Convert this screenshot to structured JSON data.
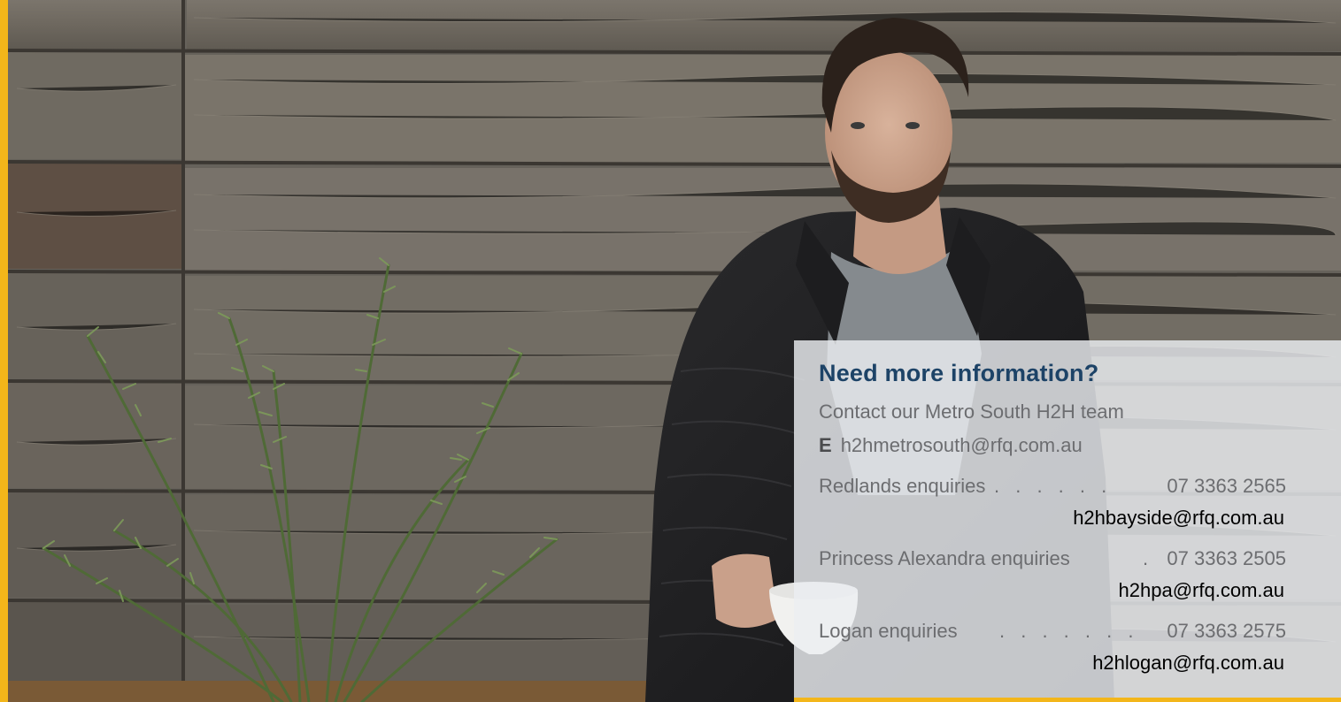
{
  "panel": {
    "title": "Need more information?",
    "intro": "Contact our Metro South H2H team",
    "email_prefix": "E",
    "email": "h2hmetrosouth@rfq.com.au",
    "contacts": [
      {
        "label": "Redlands enquiries",
        "dots": ". . . . . .",
        "phone": "07 3363 2565",
        "email": "h2hbayside@rfq.com.au"
      },
      {
        "label": "Princess Alexandra enquiries",
        "dots": ".",
        "phone": "07 3363 2505",
        "email": "h2hpa@rfq.com.au"
      },
      {
        "label": "Logan enquiries",
        "dots": ". . . . . . .",
        "phone": "07 3363 2575",
        "email": "h2hlogan@rfq.com.au"
      }
    ]
  },
  "colors": {
    "accent": "#f3b61a",
    "title": "#1d4367",
    "text": "#6c6d70"
  }
}
